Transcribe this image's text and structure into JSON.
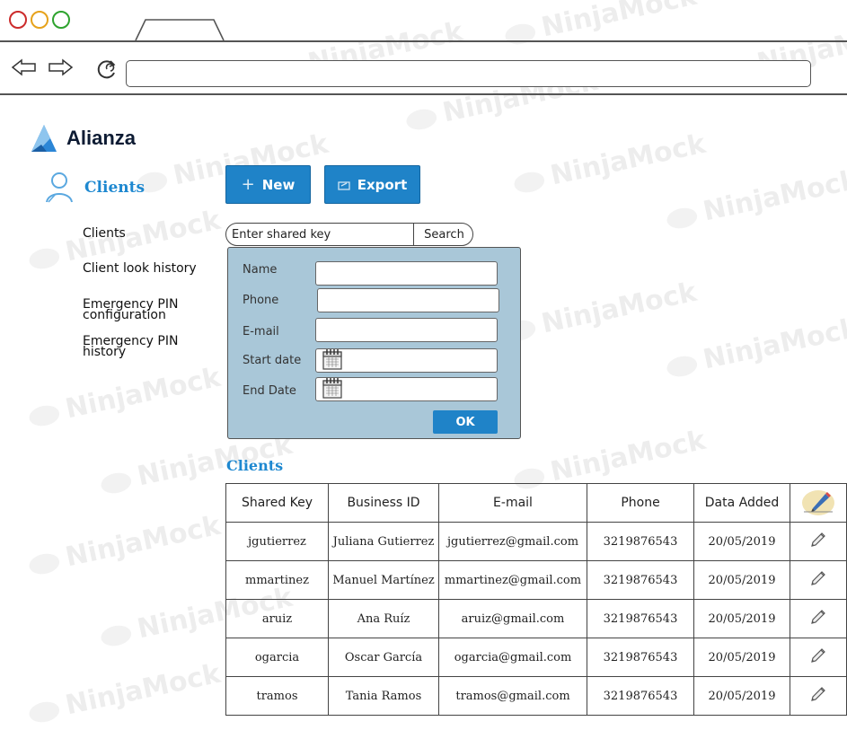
{
  "browser": {
    "url": ""
  },
  "app": {
    "brand": "Alianza"
  },
  "sidebar": {
    "header": "Clients",
    "items": [
      {
        "label": "Clients"
      },
      {
        "label": "Client look history"
      },
      {
        "label": "Emergency PIN\nconfiguration"
      },
      {
        "label": "Emergency PIN\nhistory"
      }
    ]
  },
  "toolbar": {
    "new_label": "New",
    "export_label": "Export"
  },
  "search": {
    "placeholder": "Enter shared key",
    "button_label": "Search"
  },
  "form": {
    "name_label": "Name",
    "phone_label": "Phone",
    "email_label": "E-mail",
    "start_label": "Start date",
    "end_label": "End Date",
    "ok_label": "OK"
  },
  "clients": {
    "title": "Clients",
    "columns": [
      "Shared Key",
      "Business ID",
      "E-mail",
      "Phone",
      "Data Added"
    ],
    "rows": [
      {
        "key": "jgutierrez",
        "business": "Juliana Gutierrez",
        "email": "jgutierrez@gmail.com",
        "phone": "3219876543",
        "added": "20/05/2019"
      },
      {
        "key": "mmartinez",
        "business": "Manuel Martínez",
        "email": "mmartinez@gmail.com",
        "phone": "3219876543",
        "added": "20/05/2019"
      },
      {
        "key": "aruiz",
        "business": "Ana Ruíz",
        "email": "aruiz@gmail.com",
        "phone": "3219876543",
        "added": "20/05/2019"
      },
      {
        "key": "ogarcia",
        "business": "Oscar García",
        "email": "ogarcia@gmail.com",
        "phone": "3219876543",
        "added": "20/05/2019"
      },
      {
        "key": "tramos",
        "business": "Tania Ramos",
        "email": "tramos@gmail.com",
        "phone": "3219876543",
        "added": "20/05/2019"
      }
    ]
  },
  "watermark": "NinjaMock",
  "colors": {
    "accent": "#1f83c8",
    "heading": "#1e88d0",
    "panel": "#a9c7d8"
  }
}
